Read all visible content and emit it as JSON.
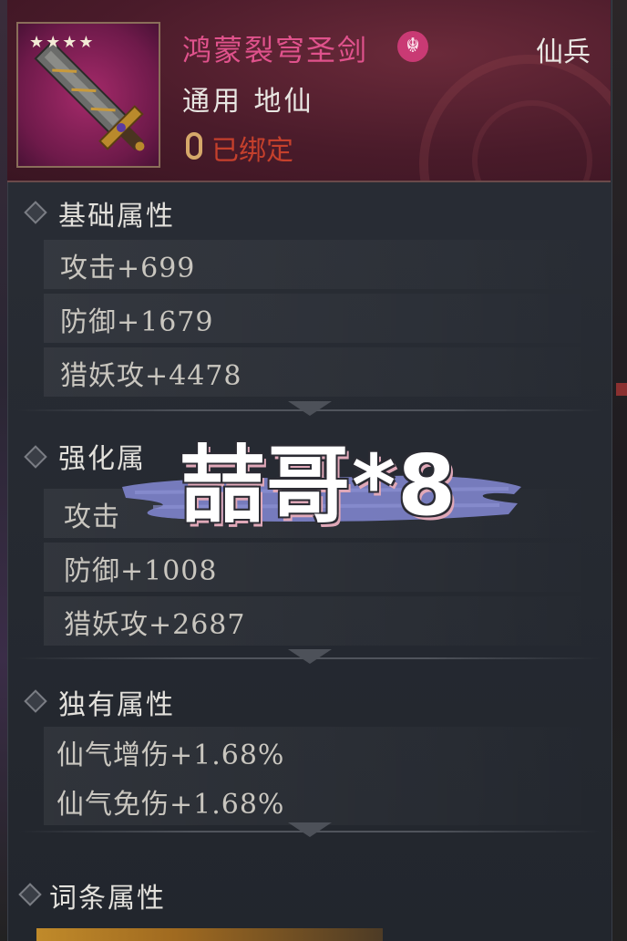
{
  "item": {
    "stars": "★★★★",
    "name": "鸿蒙裂穹圣剑",
    "quality": "仙兵",
    "type": "通用 地仙",
    "bind_status": "已绑定",
    "name_color": "#e0528c",
    "bind_color": "#c5402c"
  },
  "sections": {
    "base": {
      "title": "基础属性",
      "stats": [
        "攻击+699",
        "防御+1679",
        "猎妖攻+4478"
      ]
    },
    "enhance": {
      "title": "强化属性",
      "title_visible": "强化属",
      "stats": [
        "攻击",
        "防御+1008",
        "猎妖攻+2687"
      ]
    },
    "unique": {
      "title": "独有属性",
      "stats": [
        "仙气增伤+1.68%",
        "仙气免伤+1.68%"
      ]
    },
    "affix": {
      "title": "词条属性"
    }
  },
  "watermark": "喆哥*8",
  "icons": {
    "section_marker": "diamond-icon",
    "bind": "chain-link-icon",
    "emblem": "sect-emblem-icon",
    "weapon": "sword-icon"
  }
}
